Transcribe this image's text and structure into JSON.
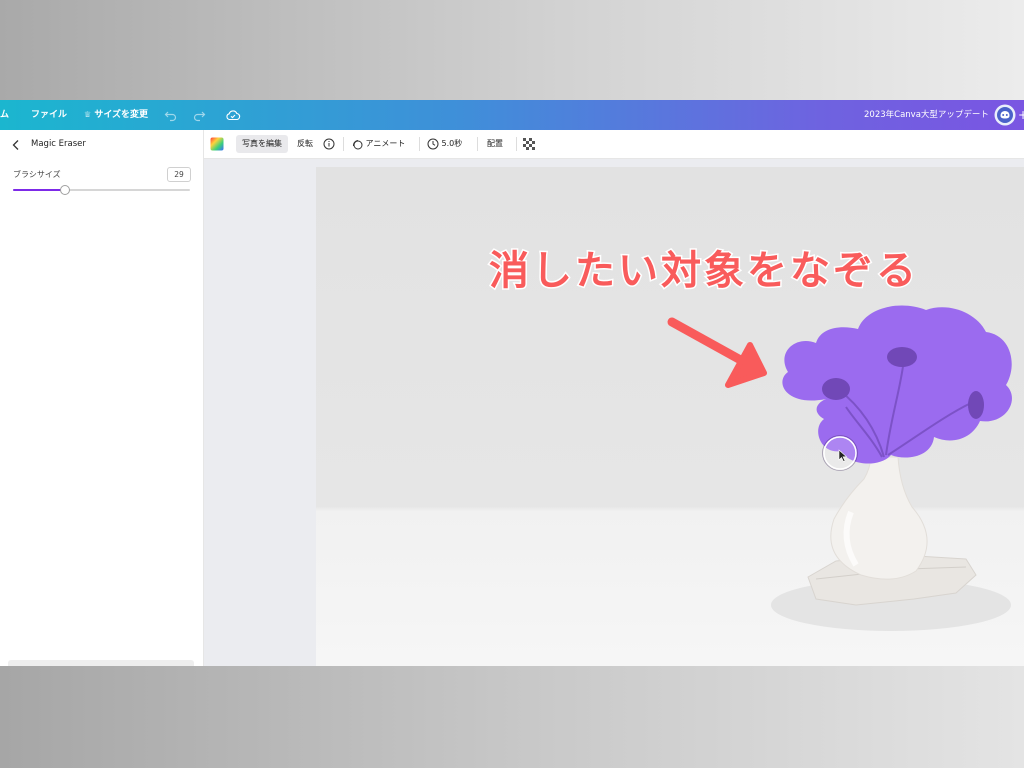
{
  "topbar": {
    "home_fragment": "ム",
    "file_label": "ファイル",
    "resize_label": "サイズを変更",
    "resize_icon": "crown-icon",
    "doc_title": "2023年Canva大型アップデート"
  },
  "sidebar": {
    "title": "Magic Eraser",
    "brush_label": "ブラシサイズ",
    "brush_value": "29",
    "brush_fraction": 0.29
  },
  "toolbar": {
    "edit_photo": "写真を編集",
    "flip": "反転",
    "animate": "アニメート",
    "duration": "5.0秒",
    "position": "配置"
  },
  "canvas": {
    "annotation_text": "消したい対象をなぞる",
    "annotation_color": "#f95b5b",
    "mask_color": "#9b6bef"
  },
  "colors": {
    "accent": "#7d2ae8",
    "topbar_start": "#1bb6cf",
    "topbar_end": "#7a55e2"
  }
}
